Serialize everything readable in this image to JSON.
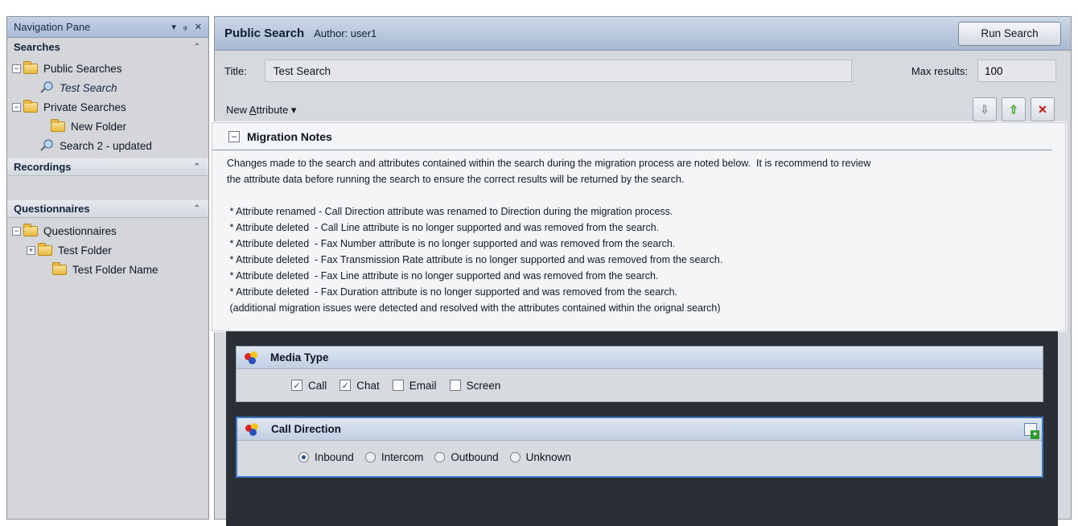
{
  "nav": {
    "title": "Navigation Pane",
    "header_icons": [
      "▾",
      "ᵩ",
      "✕"
    ],
    "sections": {
      "searches": "Searches",
      "recordings": "Recordings",
      "questionnaires": "Questionnaires"
    },
    "tree": {
      "public_searches": "Public Searches",
      "test_search": "Test Search",
      "private_searches": "Private Searches",
      "new_folder": "New Folder",
      "search2": "Search 2 - updated",
      "questionnaires_root": "Questionnaires",
      "test_folder": "Test Folder",
      "test_folder_name": "Test Folder Name"
    }
  },
  "search": {
    "heading": "Public Search",
    "author": "Author: user1",
    "run_button": "Run Search",
    "title_label": "Title:",
    "title_value": "Test Search",
    "max_label": "Max results:",
    "max_value": "100",
    "new_attribute_prefix": "New ",
    "new_attribute_underlined": "A",
    "new_attribute_suffix": "ttribute ▾"
  },
  "toolbar": {
    "move_down": "⇩",
    "move_up": "⇧",
    "delete": "✕"
  },
  "notes": {
    "toggle": "−",
    "title": "Migration Notes",
    "body": "Changes made to the search and attributes contained within the search during the migration process are noted below.  It is recommend to review\nthe attribute data before running the search to ensure the correct results will be returned by the search.\n\n * Attribute renamed - Call Direction attribute was renamed to Direction during the migration process.\n * Attribute deleted  - Call Line attribute is no longer supported and was removed from the search.\n * Attribute deleted  - Fax Number attribute is no longer supported and was removed from the search.\n * Attribute deleted  - Fax Transmission Rate attribute is no longer supported and was removed from the search.\n * Attribute deleted  - Fax Line attribute is no longer supported and was removed from the search.\n * Attribute deleted  - Fax Duration attribute is no longer supported and was removed from the search.\n (additional migration issues were detected and resolved with the attributes contained within the orignal search)"
  },
  "media_type": {
    "title": "Media Type",
    "options": [
      {
        "label": "Call",
        "checked": true
      },
      {
        "label": "Chat",
        "checked": true
      },
      {
        "label": "Email",
        "checked": false
      },
      {
        "label": "Screen",
        "checked": false
      }
    ]
  },
  "call_direction": {
    "title": "Call Direction",
    "options": [
      {
        "label": "Inbound",
        "selected": true
      },
      {
        "label": "Intercom",
        "selected": false
      },
      {
        "label": "Outbound",
        "selected": false
      },
      {
        "label": "Unknown",
        "selected": false
      }
    ]
  },
  "colors": {
    "accent_blue": "#3e78c8",
    "header_blue": "#a8b9d0",
    "dark_panel": "#2a2f36",
    "up_green": "#2ea01e",
    "delete_red": "#c21515"
  }
}
